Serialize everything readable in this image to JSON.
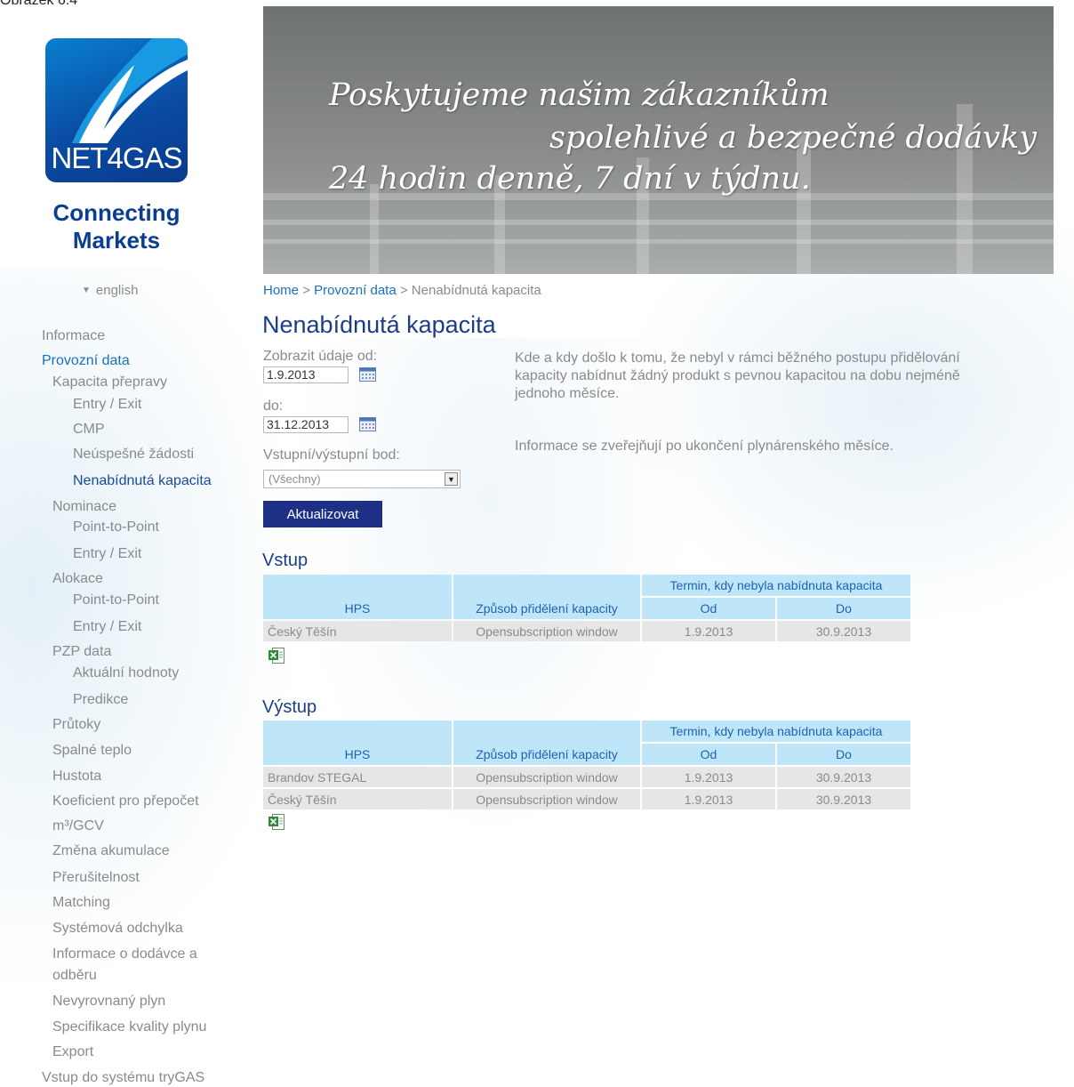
{
  "caption": "Obrázek 6.4",
  "logo": {
    "text": "NET4GAS",
    "tagline_1": "Connecting",
    "tagline_2": "Markets"
  },
  "language_link": "english",
  "banner": {
    "line1": "Poskytujeme našim zákazníkům",
    "line2": "spolehlivé a bezpečné dodávky",
    "line3": "24 hodin denně, 7 dní v týdnu."
  },
  "breadcrumb": {
    "home": "Home",
    "sep": ">",
    "section": "Provozní data",
    "current": "Nenabídnutá kapacita"
  },
  "page_title": "Nenabídnutá kapacita",
  "menu": [
    {
      "label": "Informace",
      "level": 1
    },
    {
      "label": "Provozní data",
      "level": 1
    },
    {
      "label": "Kapacita přepravy",
      "level": 2
    },
    {
      "label": "Entry / Exit",
      "level": 3
    },
    {
      "label": "CMP",
      "level": 3
    },
    {
      "label": "Neúspešné žádosti",
      "level": 3
    },
    {
      "label": "Nenabídnutá kapacita",
      "level": 3
    },
    {
      "label": "Nominace",
      "level": 2
    },
    {
      "label": "Point-to-Point",
      "level": 3
    },
    {
      "label": "Entry / Exit",
      "level": 3
    },
    {
      "label": "Alokace",
      "level": 2
    },
    {
      "label": "Point-to-Point",
      "level": 3
    },
    {
      "label": "Entry / Exit",
      "level": 3
    },
    {
      "label": "PZP data",
      "level": 2
    },
    {
      "label": "Aktuální hodnoty",
      "level": 3
    },
    {
      "label": "Predikce",
      "level": 3
    },
    {
      "label": "Průtoky",
      "level": 2
    },
    {
      "label": "Spalné teplo",
      "level": 2
    },
    {
      "label": "Hustota",
      "level": 2
    },
    {
      "label": "Koeficient pro přepočet",
      "level": 2
    },
    {
      "label": "m³/GCV",
      "level": 2
    },
    {
      "label": "Změna akumulace",
      "level": 2
    },
    {
      "label": "Přerušitelnost",
      "level": 2
    },
    {
      "label": "Matching",
      "level": 2
    },
    {
      "label": "Systémová odchylka",
      "level": 2
    },
    {
      "label": "Informace o dodávce a",
      "level": 2
    },
    {
      "label": "odběru",
      "level": 2
    },
    {
      "label": "Nevyrovnaný plyn",
      "level": 2
    },
    {
      "label": "Specifikace kvality plynu",
      "level": 2
    },
    {
      "label": "Export",
      "level": 2
    },
    {
      "label": "Vstup do systému tryGAS",
      "level": 1
    }
  ],
  "filters": {
    "from_label": "Zobrazit údaje od:",
    "from_value": "1.9.2013",
    "to_label": "do:",
    "to_value": "31.12.2013",
    "point_label": "Vstupní/výstupní bod:",
    "point_value": "(Všechny)",
    "submit_label": "Aktualizovat"
  },
  "description": "Kde a kdy došlo k tomu, že nebyl v rámci běžného postupu přidělování kapacity nabídnut žádný produkt s pevnou kapacitou na dobu nejméně jednoho měsíce.",
  "note": "Informace se zveřejňují po ukončení plynárenského měsíce.",
  "headers": {
    "hps": "HPS",
    "method": "Způsob přidělení kapacity",
    "term": "Termin, kdy nebyla nabídnuta kapacita",
    "od": "Od",
    "do": "Do"
  },
  "vstup": {
    "title": "Vstup",
    "rows": [
      {
        "hps": "Český Těšín",
        "method": "Opensubscription window",
        "od": "1.9.2013",
        "do": "30.9.2013"
      }
    ]
  },
  "vystup": {
    "title": "Výstup",
    "rows": [
      {
        "hps": "Brandov STEGAL",
        "method": "Opensubscription window",
        "od": "1.9.2013",
        "do": "30.9.2013"
      },
      {
        "hps": "Český Těšín",
        "method": "Opensubscription window",
        "od": "1.9.2013",
        "do": "30.9.2013"
      }
    ]
  },
  "colors": {
    "brand_blue": "#1b3e86",
    "link": "#1a6fbf",
    "header_bg": "#bfe5f8",
    "button": "#1e2f86"
  }
}
